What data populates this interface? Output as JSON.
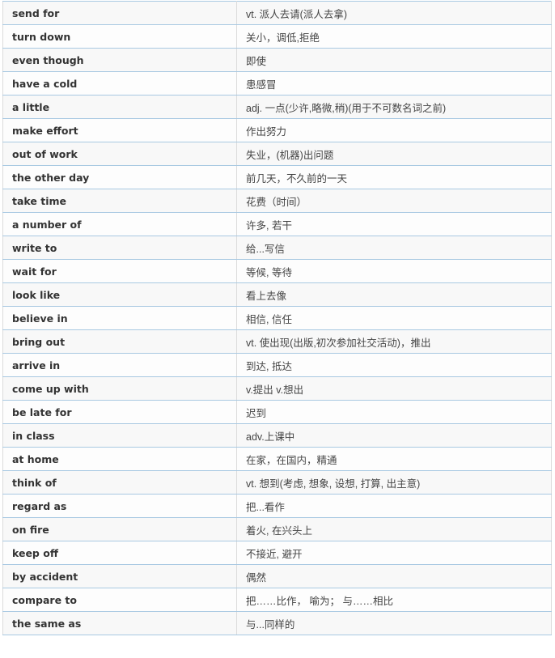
{
  "table": {
    "rows": [
      {
        "phrase": "send for",
        "meaning": "vt. 派人去请(派人去拿)"
      },
      {
        "phrase": "turn down",
        "meaning": "关小，调低,拒绝"
      },
      {
        "phrase": "even though",
        "meaning": "即使"
      },
      {
        "phrase": "have a cold",
        "meaning": "患感冒"
      },
      {
        "phrase": "a little",
        "meaning": "adj.  一点(少许,略微,稍)(用于不可数名词之前)"
      },
      {
        "phrase": "make effort",
        "meaning": "作出努力"
      },
      {
        "phrase": "out of work",
        "meaning": "失业，(机器)出问题"
      },
      {
        "phrase": "the other day",
        "meaning": "前几天，不久前的一天"
      },
      {
        "phrase": "take time",
        "meaning": "花费（时间）"
      },
      {
        "phrase": "a number of",
        "meaning": "许多, 若干"
      },
      {
        "phrase": "write to",
        "meaning": "给...写信"
      },
      {
        "phrase": "wait for",
        "meaning": "等候, 等待"
      },
      {
        "phrase": "look like",
        "meaning": "看上去像"
      },
      {
        "phrase": "believe in",
        "meaning": "相信, 信任"
      },
      {
        "phrase": "bring out",
        "meaning": "vt.  使出现(出版,初次参加社交活动)，推出"
      },
      {
        "phrase": "arrive in",
        "meaning": "到达, 抵达"
      },
      {
        "phrase": "come up with",
        "meaning": "v.提出 v.想出"
      },
      {
        "phrase": "be late for",
        "meaning": "迟到"
      },
      {
        "phrase": "in class",
        "meaning": "adv.上课中"
      },
      {
        "phrase": "at home",
        "meaning": "在家，在国内，精通"
      },
      {
        "phrase": "think of",
        "meaning": "vt. 想到(考虑, 想象,  设想, 打算, 出主意)"
      },
      {
        "phrase": "regard as",
        "meaning": "把...看作"
      },
      {
        "phrase": "on fire",
        "meaning": "着火, 在兴头上"
      },
      {
        "phrase": "keep off",
        "meaning": "不接近, 避开"
      },
      {
        "phrase": "by accident",
        "meaning": "偶然"
      },
      {
        "phrase": "compare to",
        "meaning": "把……比作， 喻为； 与……相比"
      },
      {
        "phrase": "the same as",
        "meaning": "与...同样的"
      }
    ]
  }
}
